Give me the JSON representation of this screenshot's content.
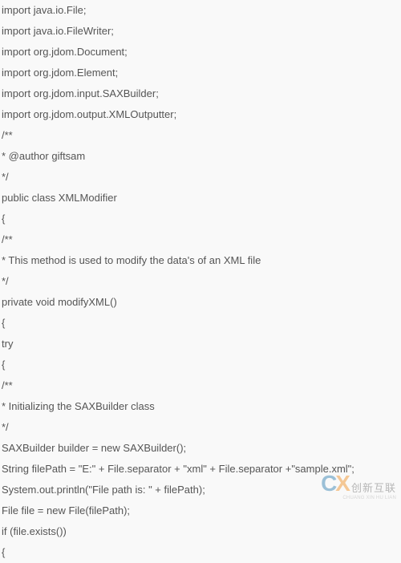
{
  "code": {
    "lines": [
      "import java.io.File;",
      "import java.io.FileWriter;",
      "import org.jdom.Document;",
      "import org.jdom.Element;",
      "import org.jdom.input.SAXBuilder;",
      "import org.jdom.output.XMLOutputter;",
      "/**",
      "* @author giftsam",
      "*/",
      "public class XMLModifier",
      "{",
      "/**",
      "* This method is used to modify the data's of an XML file",
      "*/",
      "private void modifyXML()",
      "{",
      "try",
      "{",
      "/**",
      "* Initializing the SAXBuilder class",
      "*/",
      "SAXBuilder builder = new SAXBuilder();",
      "String filePath = \"E:\" + File.separator + \"xml\" + File.separator +\"sample.xml\";",
      "System.out.println(\"File path is: \" + filePath);",
      "File file = new File(filePath);",
      "if (file.exists())",
      "{"
    ]
  },
  "watermark": {
    "letter_c": "C",
    "letter_x": "X",
    "brand_cn": "创新互联",
    "brand_py": "CHUANG XIN HU LIAN"
  }
}
